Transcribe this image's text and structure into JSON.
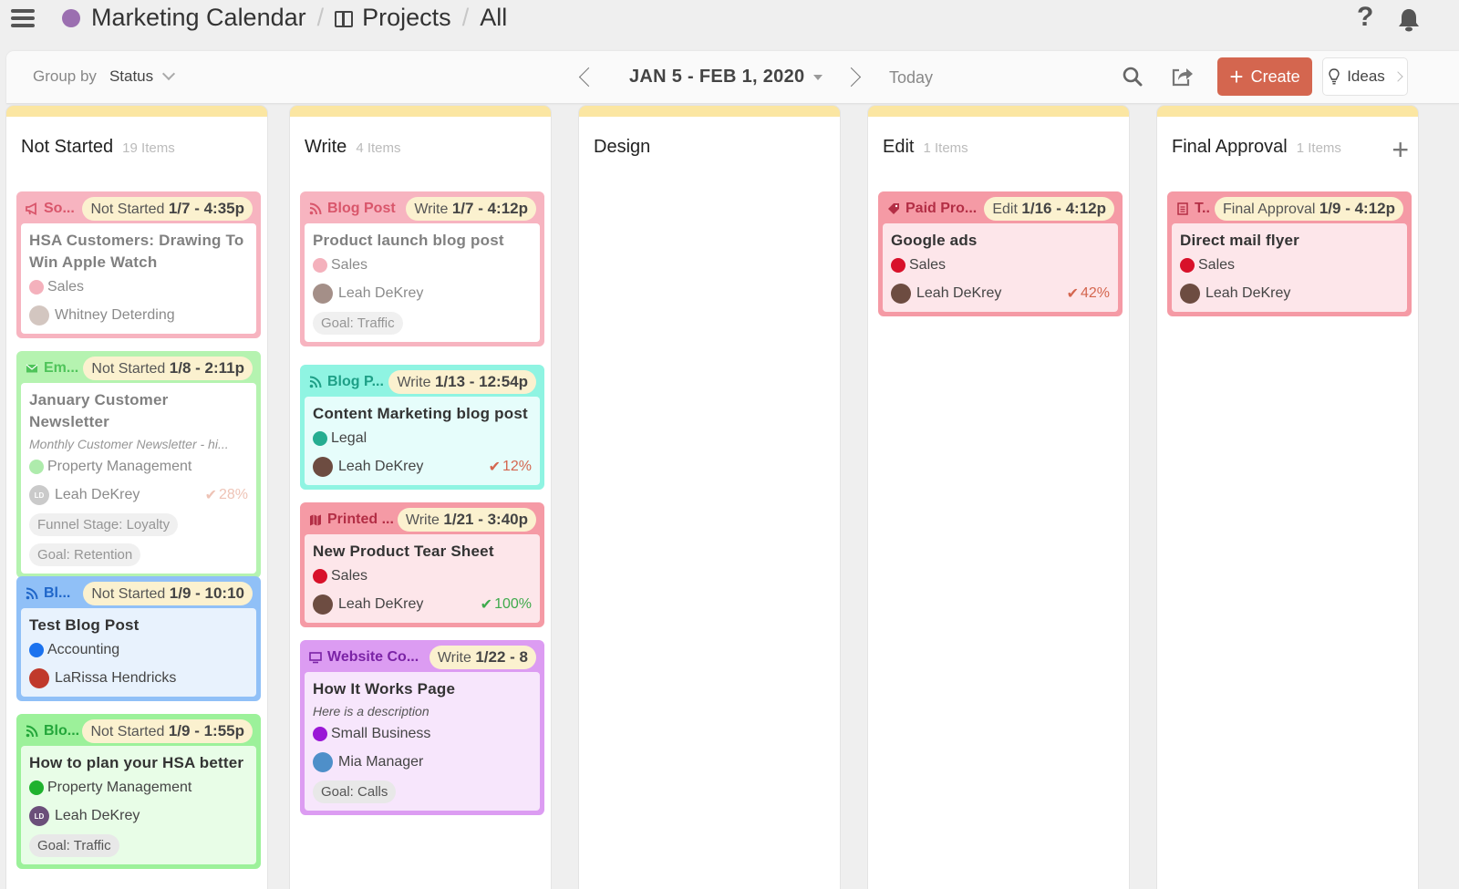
{
  "header": {
    "app_title": "Marketing Calendar",
    "breadcrumb_projects": "Projects",
    "breadcrumb_all": "All",
    "separator": "/",
    "help_label": "?"
  },
  "toolbar": {
    "group_by_label": "Group by",
    "group_by_value": "Status",
    "date_range": "JAN 5 - FEB 1, 2020",
    "today_label": "Today",
    "create_label": "Create",
    "ideas_label": "Ideas"
  },
  "colors": {
    "accent": "#d4664f",
    "column_top": "#fbe6a2",
    "status_pill": "#fbf1cf"
  },
  "columns": [
    {
      "title": "Not Started",
      "count": "19 Items",
      "cards": [
        {
          "type": "So...",
          "type_icon": "megaphone-icon",
          "status": "Not Started",
          "date": "1/7 - 4:35p",
          "title": "HSA Customers: Drawing To Win Apple Watch",
          "tag": "Sales",
          "user": "Whitney Deterding",
          "theme": "pink",
          "faded": true
        },
        {
          "type": "Em...",
          "type_icon": "envelope-icon",
          "status": "Not Started",
          "date": "1/8 - 2:11p",
          "title": "January Customer Newsletter",
          "desc": "Monthly Customer Newsletter - hi...",
          "tag": "Property Management",
          "user": "Leah DeKrey",
          "user_initials": "LD",
          "progress": "28%",
          "pills": [
            "Funnel Stage: Loyalty",
            "Goal: Retention"
          ],
          "theme": "lightgreen",
          "faded": true
        },
        {
          "type": "Bl...",
          "type_icon": "rss-icon",
          "status": "Not Started",
          "date": "1/9 - 10:10",
          "title": "Test Blog Post",
          "tag": "Accounting",
          "user": "LaRissa Hendricks",
          "theme": "blue"
        },
        {
          "type": "Blo...",
          "type_icon": "rss-icon",
          "status": "Not Started",
          "date": "1/9 - 1:55p",
          "title": "How to plan your HSA better",
          "tag": "Property Management",
          "user": "Leah DeKrey",
          "user_initials": "LD",
          "pills": [
            "Goal: Traffic"
          ],
          "theme": "green"
        }
      ]
    },
    {
      "title": "Write",
      "count": "4 Items",
      "cards": [
        {
          "type": "Blog Post",
          "type_icon": "rss-icon",
          "status": "Write",
          "date": "1/7 - 4:12p",
          "title": "Product launch blog post",
          "tag": "Sales",
          "user": "Leah DeKrey",
          "pills": [
            "Goal: Traffic"
          ],
          "theme": "pink",
          "faded": true
        },
        {
          "type": "Blog P...",
          "type_icon": "rss-icon",
          "status": "Write",
          "date": "1/13 - 12:54p",
          "title": "Content Marketing blog post",
          "tag": "Legal",
          "user": "Leah DeKrey",
          "progress": "12%",
          "theme": "teal"
        },
        {
          "type": "Printed ...",
          "type_icon": "map-icon",
          "status": "Write",
          "date": "1/21 - 3:40p",
          "title": "New Product Tear Sheet",
          "tag": "Sales",
          "user": "Leah DeKrey",
          "progress": "100%",
          "theme": "red"
        },
        {
          "type": "Website Co...",
          "type_icon": "monitor-icon",
          "status": "Write",
          "date": "1/22 - 8",
          "title": "How It Works Page",
          "desc": "Here is a description",
          "tag": "Small Business",
          "user": "Mia Manager",
          "pills": [
            "Goal: Calls"
          ],
          "theme": "purple"
        }
      ]
    },
    {
      "title": "Design",
      "count": "",
      "cards": []
    },
    {
      "title": "Edit",
      "count": "1 Items",
      "cards": [
        {
          "type": "Paid Pro...",
          "type_icon": "tag-icon",
          "status": "Edit",
          "date": "1/16 - 4:12p",
          "title": "Google ads",
          "tag": "Sales",
          "user": "Leah DeKrey",
          "progress": "42%",
          "theme": "red"
        }
      ]
    },
    {
      "title": "Final Approval",
      "count": "1 Items",
      "cards": [
        {
          "type": "T..",
          "type_icon": "document-icon",
          "status": "Final Approval",
          "date": "1/9 - 4:12p",
          "title": "Direct mail flyer",
          "tag": "Sales",
          "user": "Leah DeKrey",
          "theme": "red"
        }
      ]
    }
  ]
}
